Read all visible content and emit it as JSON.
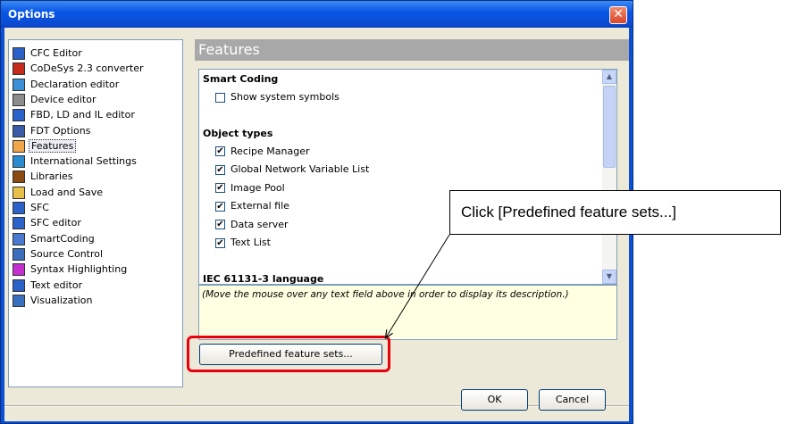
{
  "window": {
    "title": "Options",
    "close_glyph": "✕"
  },
  "tree": {
    "items": [
      {
        "label": "CFC Editor",
        "icon": "cfc-editor-icon",
        "color": "#2a62c9"
      },
      {
        "label": "CoDeSys 2.3 converter",
        "icon": "converter-icon",
        "color": "#c62a1c"
      },
      {
        "label": "Declaration editor",
        "icon": "declaration-editor-icon",
        "color": "#3a8fd6"
      },
      {
        "label": "Device editor",
        "icon": "device-editor-icon",
        "color": "#8c8c8c"
      },
      {
        "label": "FBD, LD and IL editor",
        "icon": "fbd-ld-il-editor-icon",
        "color": "#2a62c9"
      },
      {
        "label": "FDT Options",
        "icon": "fdt-options-icon",
        "color": "#3a5ca8"
      },
      {
        "label": "Features",
        "icon": "features-icon",
        "color": "#f2a64a",
        "selected": true
      },
      {
        "label": "International Settings",
        "icon": "globe-icon",
        "color": "#2b8bd0"
      },
      {
        "label": "Libraries",
        "icon": "libraries-icon",
        "color": "#8a4a10"
      },
      {
        "label": "Load and Save",
        "icon": "folder-icon",
        "color": "#e6c04a"
      },
      {
        "label": "SFC",
        "icon": "sfc-icon",
        "color": "#2a62c9"
      },
      {
        "label": "SFC editor",
        "icon": "sfc-editor-icon",
        "color": "#2a62c9"
      },
      {
        "label": "SmartCoding",
        "icon": "smartcoding-icon",
        "color": "#4a7ad0"
      },
      {
        "label": "Source Control",
        "icon": "source-control-icon",
        "color": "#3a6fc0"
      },
      {
        "label": "Syntax Highlighting",
        "icon": "syntax-highlighting-icon",
        "color": "#c32fd0"
      },
      {
        "label": "Text editor",
        "icon": "text-editor-icon",
        "color": "#2a62c9"
      },
      {
        "label": "Visualization",
        "icon": "visualization-icon",
        "color": "#3a6fc0"
      }
    ]
  },
  "pane": {
    "title": "Features",
    "sections": [
      {
        "heading": "Smart Coding",
        "options": [
          {
            "label": "Show system symbols",
            "checked": false
          }
        ]
      },
      {
        "heading": "Object types",
        "options": [
          {
            "label": "Recipe Manager",
            "checked": true
          },
          {
            "label": "Global Network Variable List",
            "checked": true
          },
          {
            "label": "Image Pool",
            "checked": true
          },
          {
            "label": "External file",
            "checked": true
          },
          {
            "label": "Data server",
            "checked": true
          },
          {
            "label": "Text List",
            "checked": true
          }
        ]
      },
      {
        "heading": "IEC 61131-3 language",
        "options": []
      }
    ],
    "description": "(Move the mouse over any text field above in order to display its description.)",
    "scroll_up": "▲",
    "scroll_down": "▼"
  },
  "buttons": {
    "predefined": "Predefined feature sets...",
    "ok": "OK",
    "cancel": "Cancel"
  },
  "callout": {
    "text": "Click [Predefined feature sets...]"
  },
  "colors": {
    "highlight": "#e8000c",
    "title_bar": "#0a4ad0",
    "description_bg": "#ffffe1"
  }
}
